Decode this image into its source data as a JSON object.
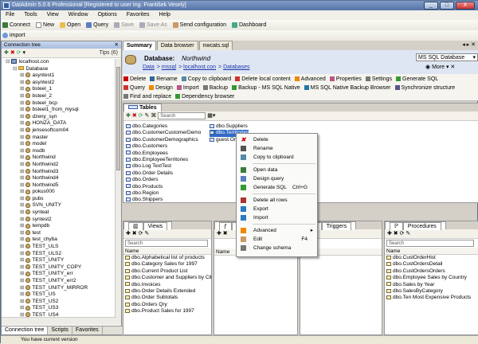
{
  "window": {
    "title": "DatAdmin 5.0.6 Professional [Registered to user Ing. František Veselý]",
    "min": "_",
    "max": "□",
    "close": "X"
  },
  "menu": [
    "File",
    "Tools",
    "View",
    "Window",
    "Options",
    "Favorites",
    "Help"
  ],
  "toolbar1": [
    "Connect",
    "New",
    "Open",
    "Query",
    "Save",
    "Save As",
    "Send configuration",
    "Dashboard"
  ],
  "toolbar2": {
    "import": "import"
  },
  "leftpanel": {
    "title": "Connection tree",
    "tips": "Tips (6)",
    "tree": [
      {
        "label": "localhost.con",
        "kind": "server",
        "indent": 1
      },
      {
        "label": "Database",
        "kind": "folder",
        "indent": 2
      },
      {
        "label": "asyntest1",
        "kind": "db",
        "indent": 3
      },
      {
        "label": "asyntest2",
        "kind": "db",
        "indent": 3
      },
      {
        "label": "bsteel_1",
        "kind": "db",
        "indent": 3
      },
      {
        "label": "bsteel_2",
        "kind": "db",
        "indent": 3
      },
      {
        "label": "bsteel_bcp",
        "kind": "db",
        "indent": 3
      },
      {
        "label": "bsteel1_from_mysql",
        "kind": "db",
        "indent": 3
      },
      {
        "label": "dzeny_syn",
        "kind": "db",
        "indent": 3
      },
      {
        "label": "HONZA_DATA",
        "kind": "db",
        "indent": 3
      },
      {
        "label": "jensesoftcom04",
        "kind": "db",
        "indent": 3
      },
      {
        "label": "master",
        "kind": "db",
        "indent": 3
      },
      {
        "label": "model",
        "kind": "db",
        "indent": 3
      },
      {
        "label": "msdb",
        "kind": "db",
        "indent": 3
      },
      {
        "label": "Northwind",
        "kind": "db",
        "indent": 3
      },
      {
        "label": "Northwind2",
        "kind": "db",
        "indent": 3
      },
      {
        "label": "Northwind3",
        "kind": "db",
        "indent": 3
      },
      {
        "label": "Northwind4",
        "kind": "db",
        "indent": 3
      },
      {
        "label": "Northwind5",
        "kind": "db",
        "indent": 3
      },
      {
        "label": "pokus000",
        "kind": "db",
        "indent": 3
      },
      {
        "label": "pubs",
        "kind": "db",
        "indent": 3
      },
      {
        "label": "SVN_UNITY",
        "kind": "db",
        "indent": 3
      },
      {
        "label": "synteat",
        "kind": "db",
        "indent": 3
      },
      {
        "label": "syntest2",
        "kind": "db",
        "indent": 3
      },
      {
        "label": "tempdb",
        "kind": "db",
        "indent": 3
      },
      {
        "label": "test",
        "kind": "db",
        "indent": 3
      },
      {
        "label": "test_chyba",
        "kind": "db",
        "indent": 3
      },
      {
        "label": "TEST_ULS",
        "kind": "db",
        "indent": 3
      },
      {
        "label": "TEST_ULS2",
        "kind": "db",
        "indent": 3
      },
      {
        "label": "TEST_UNITY",
        "kind": "db",
        "indent": 3
      },
      {
        "label": "TEST_UNITY_COPY",
        "kind": "db",
        "indent": 3
      },
      {
        "label": "TEST_UNITY_err",
        "kind": "db",
        "indent": 3
      },
      {
        "label": "TEST_UNITY_err2",
        "kind": "db",
        "indent": 3
      },
      {
        "label": "TEST_UNITY_MIRROR",
        "kind": "db",
        "indent": 3
      },
      {
        "label": "TEST_US",
        "kind": "db",
        "indent": 3
      },
      {
        "label": "TEST_US2",
        "kind": "db",
        "indent": 3
      },
      {
        "label": "TEST_US3",
        "kind": "db",
        "indent": 3
      },
      {
        "label": "TEST_US4",
        "kind": "db",
        "indent": 3
      }
    ],
    "tabs": [
      "Connection tree",
      "Scripts",
      "Favorites"
    ]
  },
  "doctabs": [
    "Summary",
    "Data browser",
    "nwcats.sql"
  ],
  "dbheader": {
    "label": "Database:",
    "name": "Northwind",
    "dialect": "MS SQL Database",
    "more": "More",
    "breadcrumb": [
      "Data",
      "mssql",
      "localhost.con",
      "Databases"
    ]
  },
  "actions": {
    "row1": [
      "Delete",
      "Rename",
      "Copy to clipboard",
      "Delete local content",
      "Advanced",
      "Properties",
      "Settings",
      "Generate SQL"
    ],
    "row2": [
      "Query",
      "Design",
      "Import",
      "Backup",
      "Backup - MS SQL Native",
      "MS SQL Native Backup Browser",
      "Synchronize structure"
    ],
    "row3": [
      "Find and replace",
      "Dependency browser"
    ]
  },
  "tables": {
    "title": "Tables",
    "search": "Search",
    "col1": [
      "dbo.Categories",
      "dbo.CustomerCustomerDemo",
      "dbo.CustomerDemographics",
      "dbo.Customers",
      "dbo.Employees",
      "dbo.EmployeeTerritories",
      "dbo.Log TextTest",
      "dbo.Order Details",
      "dbo.Orders",
      "dbo.Products",
      "dbo.Region",
      "dbo.Shippers"
    ],
    "col2": [
      "dbo.Suppliers",
      "dbo.Territories",
      "guest.Orders"
    ]
  },
  "contextmenu": [
    {
      "label": "Delete",
      "icon": "delete-icon"
    },
    {
      "label": "Rename",
      "icon": "rename-icon"
    },
    {
      "label": "Copy to clipboard",
      "icon": "copy-icon"
    },
    {
      "sep": true
    },
    {
      "label": "Open data",
      "icon": "open-data-icon"
    },
    {
      "label": "Design query",
      "icon": "design-query-icon"
    },
    {
      "label": "Generate SQL",
      "shortcut": "Ctrl+G",
      "icon": "generate-sql-icon"
    },
    {
      "sep": true
    },
    {
      "label": "Delete all rows",
      "icon": "delete-rows-icon"
    },
    {
      "label": "Export",
      "icon": "export-icon"
    },
    {
      "label": "Import",
      "icon": "import-icon"
    },
    {
      "sep": true
    },
    {
      "label": "Advanced",
      "submenu": true,
      "icon": "advanced-icon"
    },
    {
      "label": "Edit",
      "shortcut": "F4",
      "icon": "edit-icon"
    },
    {
      "label": "Change schema",
      "icon": "schema-icon"
    }
  ],
  "panes": {
    "views": {
      "title": "Views",
      "search": "Search",
      "col": "Name",
      "items": [
        "dbo.Alphabetical list of products",
        "dbo.Category Sales for 1997",
        "dbo.Current Product List",
        "dbo.Customer and Suppliers by Cit",
        "dbo.Invoices",
        "dbo.Order Details Extended",
        "dbo.Order Subtotals",
        "dbo.Orders Qry",
        "dbo.Product Sales for 1997"
      ]
    },
    "functions": {
      "title": "Fu",
      "col": "Name"
    },
    "triggers": {
      "title": "Triggers",
      "col": "Name"
    },
    "procedures": {
      "title": "Procedures",
      "search": "Search",
      "col": "Name",
      "items": [
        "dbo.CustOrderHist",
        "dbo.CustOrdersDetail",
        "dbo.CustOrdersOrders",
        "dbo.Employee Sales by Country",
        "dbo.Sales by Year",
        "dbo.SalesByCategory",
        "dbo.Ten Most Expensive Products"
      ]
    }
  },
  "status": "You have current version",
  "colors": {
    "accent": "#316ac5",
    "titlebar": "#5673a6",
    "link": "#1a35a8"
  }
}
